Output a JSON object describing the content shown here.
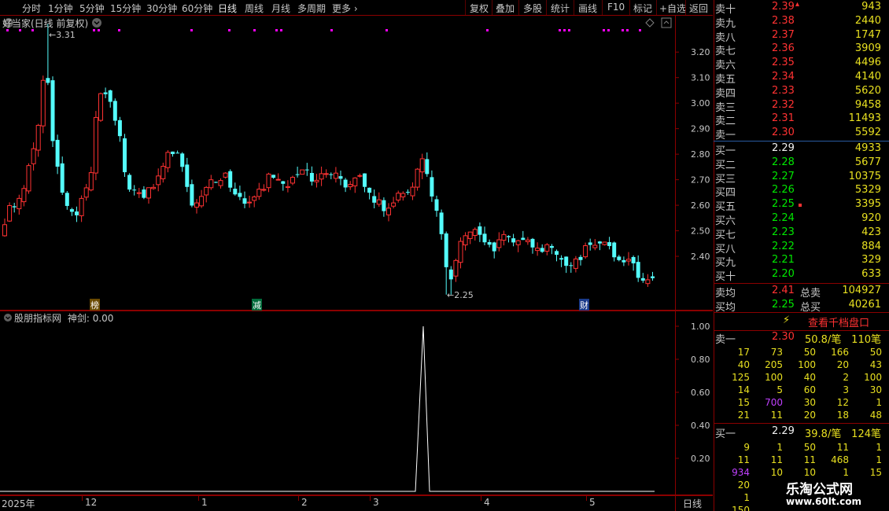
{
  "toolbar": {
    "periods": [
      "分时",
      "1分钟",
      "5分钟",
      "15分钟",
      "30分钟",
      "60分钟",
      "日线",
      "周线",
      "月线",
      "多周期",
      "更多"
    ],
    "active_period": "日线",
    "buttons": [
      "复权",
      "叠加",
      "多股",
      "统计",
      "画线",
      "F10",
      "标记",
      "+自选",
      "返回"
    ]
  },
  "main_chart": {
    "title": "好当家(日线 前复权)",
    "high_label": "3.31",
    "low_label": "2.25",
    "price_ticks": [
      "3.20",
      "3.10",
      "3.00",
      "2.90",
      "2.80",
      "2.70",
      "2.60",
      "2.50",
      "2.40"
    ],
    "markers": [
      {
        "text": "榜"
      },
      {
        "text": "减"
      },
      {
        "text": "财"
      }
    ]
  },
  "indicator": {
    "title": "股朋指标网",
    "line_label": "神剑: 0.00",
    "ticks": [
      "1.00",
      "0.80",
      "0.60",
      "0.40",
      "0.20"
    ]
  },
  "date_axis": {
    "labels": [
      "2025年",
      "12",
      "1",
      "2",
      "3",
      "4",
      "5"
    ],
    "period": "日线"
  },
  "chart_data": {
    "type": "candlestick",
    "ylim": [
      2.2,
      3.33
    ],
    "high": 3.31,
    "low": 2.25,
    "indicator_series": {
      "name": "神剑",
      "peak_value": 1.0,
      "baseline": 0.0
    }
  },
  "order_book": {
    "asks": [
      {
        "label": "卖十",
        "price": "2.39",
        "vol": "943"
      },
      {
        "label": "卖九",
        "price": "2.38",
        "vol": "2440"
      },
      {
        "label": "卖八",
        "price": "2.37",
        "vol": "1747"
      },
      {
        "label": "卖七",
        "price": "2.36",
        "vol": "3909"
      },
      {
        "label": "卖六",
        "price": "2.35",
        "vol": "4496"
      },
      {
        "label": "卖五",
        "price": "2.34",
        "vol": "4140"
      },
      {
        "label": "卖四",
        "price": "2.33",
        "vol": "5620"
      },
      {
        "label": "卖三",
        "price": "2.32",
        "vol": "9458"
      },
      {
        "label": "卖二",
        "price": "2.31",
        "vol": "11493"
      },
      {
        "label": "卖一",
        "price": "2.30",
        "vol": "5592"
      }
    ],
    "bids": [
      {
        "label": "买一",
        "price": "2.29",
        "vol": "4933",
        "color": "white"
      },
      {
        "label": "买二",
        "price": "2.28",
        "vol": "5677",
        "color": "green"
      },
      {
        "label": "买三",
        "price": "2.27",
        "vol": "10375",
        "color": "green"
      },
      {
        "label": "买四",
        "price": "2.26",
        "vol": "5329",
        "color": "green"
      },
      {
        "label": "买五",
        "price": "2.25",
        "vol": "3395",
        "color": "green"
      },
      {
        "label": "买六",
        "price": "2.24",
        "vol": "920",
        "color": "green"
      },
      {
        "label": "买七",
        "price": "2.23",
        "vol": "423",
        "color": "green"
      },
      {
        "label": "买八",
        "price": "2.22",
        "vol": "884",
        "color": "green"
      },
      {
        "label": "买九",
        "price": "2.21",
        "vol": "329",
        "color": "green"
      },
      {
        "label": "买十",
        "price": "2.20",
        "vol": "633",
        "color": "green"
      }
    ],
    "sell_avg": {
      "label": "卖均",
      "price": "2.41",
      "total_label": "总卖",
      "total": "104927"
    },
    "buy_avg": {
      "label": "买均",
      "price": "2.25",
      "total_label": "总买",
      "total": "40261"
    },
    "view_button": "查看千档盘口"
  },
  "sell1_queue": {
    "label": "卖一",
    "price": "2.30",
    "avg": "50.8/笔",
    "count": "110笔",
    "rows": [
      [
        "17",
        "73",
        "50",
        "166",
        "50"
      ],
      [
        "40",
        "205",
        "100",
        "20",
        "43"
      ],
      [
        "125",
        "100",
        "40",
        "2",
        "100"
      ],
      [
        "14",
        "5",
        "60",
        "3",
        "30"
      ],
      [
        "15",
        "700",
        "30",
        "12",
        "1"
      ],
      [
        "21",
        "11",
        "20",
        "18",
        "48"
      ]
    ]
  },
  "buy1_queue": {
    "label": "买一",
    "price": "2.29",
    "avg": "39.8/笔",
    "count": "124笔",
    "rows": [
      [
        "9",
        "1",
        "50",
        "11",
        "1"
      ],
      [
        "11",
        "11",
        "11",
        "468",
        "1"
      ],
      [
        "934",
        "10",
        "10",
        "1",
        "15"
      ],
      [
        "20",
        "",
        "",
        "",
        ""
      ],
      [
        "1",
        "",
        "",
        "",
        ""
      ],
      [
        "150",
        "",
        "",
        "",
        ""
      ]
    ]
  },
  "watermark": {
    "title": "乐淘公式网",
    "url": "www.60lt.com"
  },
  "colors": {
    "up": "#ff3232",
    "down": "#54fcfc",
    "grid": "#8b0000",
    "bg": "#000000",
    "marker": "#ff00ff",
    "text": "#c8c8c8",
    "yellow": "#e8e020"
  }
}
